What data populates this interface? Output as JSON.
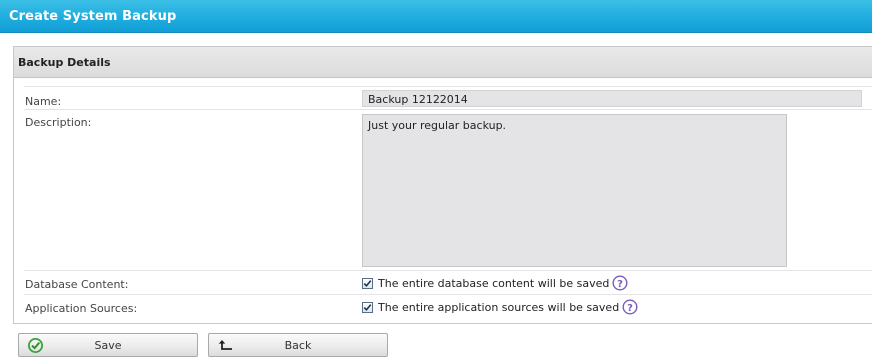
{
  "window": {
    "title": "Create System Backup"
  },
  "panel": {
    "header": "Backup Details",
    "fields": {
      "name": {
        "label": "Name:",
        "value": "Backup 12122014"
      },
      "description": {
        "label": "Description:",
        "value": "Just your regular backup."
      },
      "database_content": {
        "label": "Database Content:",
        "checked": true,
        "text": "The entire database content will be saved",
        "help_icon": "help-circle-icon"
      },
      "application_sources": {
        "label": "Application Sources:",
        "checked": true,
        "text": "The entire application sources will be saved",
        "help_icon": "help-circle-icon"
      }
    }
  },
  "buttons": {
    "save": {
      "label": "Save",
      "icon": "check-circle-icon"
    },
    "back": {
      "label": "Back",
      "icon": "back-arrow-icon"
    }
  },
  "colors": {
    "titlebar": "#22aee0",
    "field_bg": "#e4e4e6",
    "help_icon": "#7a5bbf",
    "save_icon": "#3aa23a"
  }
}
